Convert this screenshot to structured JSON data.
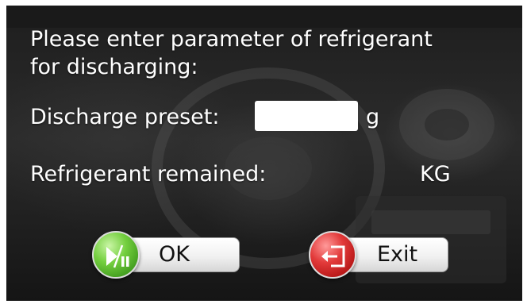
{
  "dialog": {
    "prompt_line1": "Please enter parameter of refrigerant",
    "prompt_line2": "for discharging:",
    "preset_label": "Discharge preset:",
    "preset_value": "",
    "preset_unit": "g",
    "remained_label": "Refrigerant remained:",
    "remained_unit": "KG"
  },
  "buttons": {
    "ok_label": "OK",
    "ok_icon": "play-pause-icon",
    "exit_label": "Exit",
    "exit_icon": "exit-door-icon"
  },
  "colors": {
    "ok_accent": "#4caf28",
    "exit_accent": "#d32626",
    "text": "#ffffff"
  }
}
